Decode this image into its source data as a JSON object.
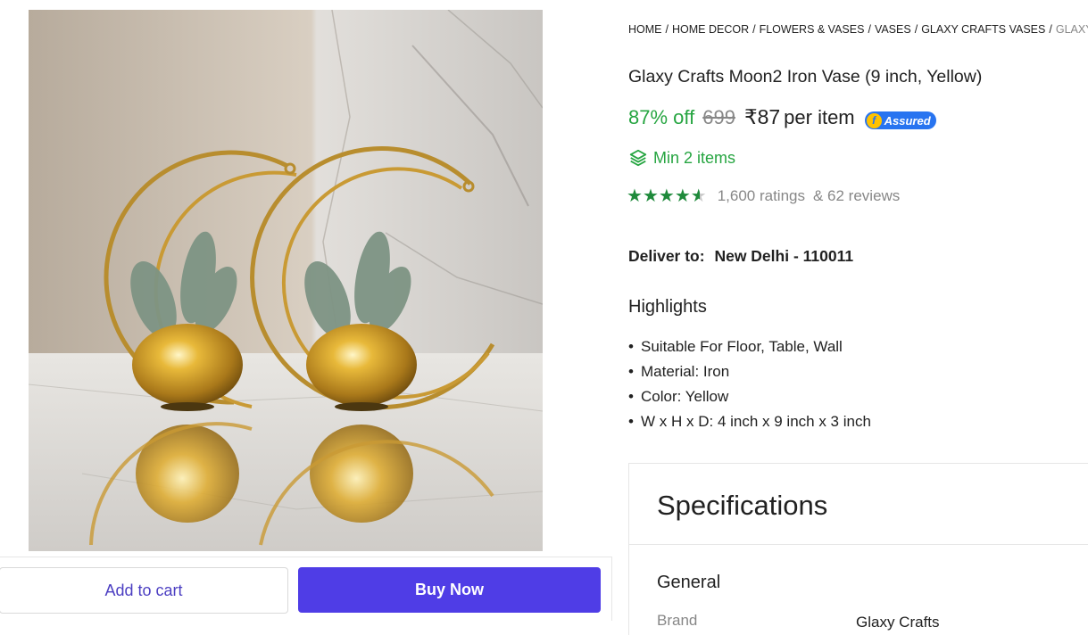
{
  "colors": {
    "discount_green": "#26a541",
    "buy_now_bg": "#4f3de6",
    "add_to_cart_text": "#4c3fc2",
    "muted_gray": "#878787",
    "assured_blue": "#2874f0",
    "rating_green": "#1f8a3b"
  },
  "product_image": {
    "alt_icon": "product-photo-two-gold-moon-vases"
  },
  "actions": {
    "add_to_cart": "Add to cart",
    "buy_now": "Buy Now"
  },
  "breadcrumb": {
    "items": [
      "HOME",
      "HOME DECOR",
      "FLOWERS & VASES",
      "VASES",
      "GLAXY CRAFTS VASES",
      "GLAXY"
    ],
    "separator": "/"
  },
  "product": {
    "title": "Glaxy Crafts Moon2 Iron Vase (9 inch, Yellow)",
    "discount": "87% off",
    "mrp": "699",
    "price": "₹87",
    "price_unit": "per item",
    "assured_logo": "f",
    "assured_label": "Assured",
    "min_items_icon": "layers-icon",
    "min_items": "Min 2 items",
    "rating_stars": 4.5,
    "ratings_count": "1,600 ratings",
    "reviews_count": "& 62 reviews"
  },
  "delivery": {
    "label": "Deliver to:",
    "location": "New Delhi - 110011"
  },
  "highlights": {
    "title": "Highlights",
    "items": [
      "Suitable For Floor, Table, Wall",
      "Material: Iron",
      "Color: Yellow",
      "W x H x D: 4 inch x 9 inch x 3 inch"
    ]
  },
  "specifications": {
    "title": "Specifications",
    "section": "General",
    "rows": [
      {
        "label": "Brand",
        "value": "Glaxy Crafts"
      }
    ]
  }
}
